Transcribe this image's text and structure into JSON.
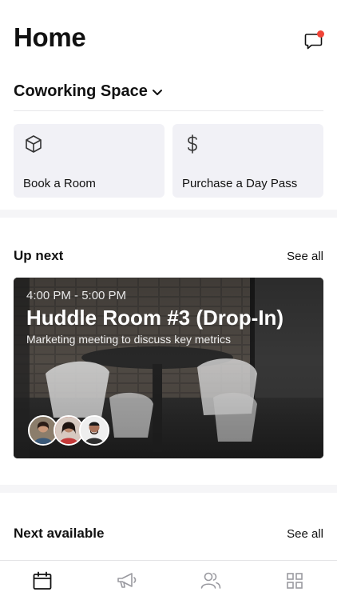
{
  "header": {
    "title": "Home",
    "chat_icon": "chat-bubble-icon",
    "has_notification": true
  },
  "space_selector": {
    "label": "Coworking Space",
    "icon": "chevron-down-icon"
  },
  "actions": [
    {
      "label": "Book a Room",
      "icon": "cube-icon"
    },
    {
      "label": "Purchase a Day Pass",
      "icon": "dollar-icon"
    }
  ],
  "up_next": {
    "title": "Up next",
    "see_all": "See all",
    "event": {
      "time": "4:00 PM - 5:00 PM",
      "room": "Huddle Room #3 (Drop-In)",
      "description": "Marketing meeting to discuss key metrics",
      "attendee_count": 3
    }
  },
  "next_available": {
    "title": "Next available",
    "see_all": "See all"
  },
  "tabbar": {
    "tabs": [
      "calendar-icon",
      "megaphone-icon",
      "people-icon",
      "grid-icon"
    ],
    "active": "calendar-icon"
  },
  "colors": {
    "notification": "#f04438",
    "card_bg": "#f1f1f6",
    "active_tab": "#111111",
    "inactive_tab": "#9a9aa0"
  }
}
